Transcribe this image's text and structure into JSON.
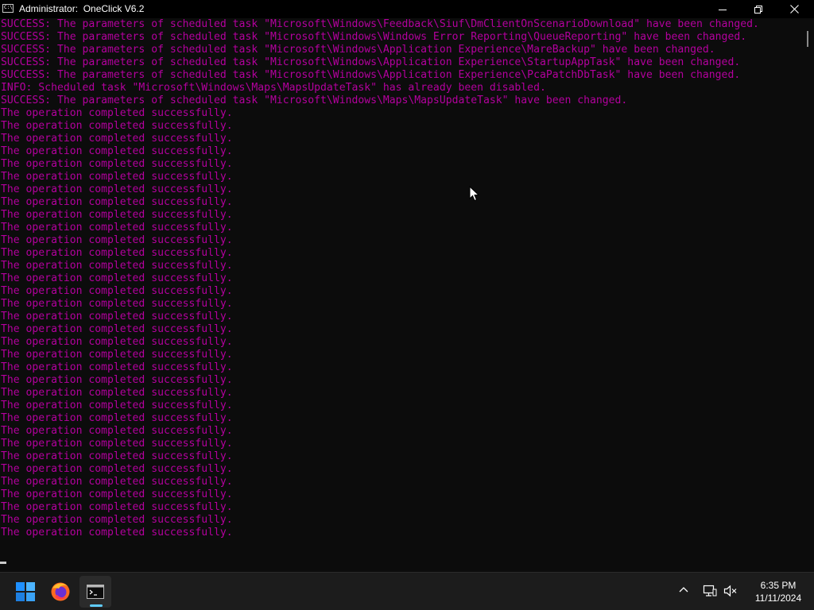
{
  "window": {
    "title": "Administrator:  OneClick V6.2",
    "icon": "command-prompt-icon",
    "icon_text": "C:\\",
    "controls": [
      "minimize-icon",
      "maximize-icon",
      "close-icon"
    ]
  },
  "console": {
    "text_color": "#b4009e",
    "background": "#0c0c0c",
    "lines": [
      "SUCCESS: The parameters of scheduled task \"Microsoft\\Windows\\Feedback\\Siuf\\DmClientOnScenarioDownload\" have been changed.",
      "SUCCESS: The parameters of scheduled task \"Microsoft\\Windows\\Windows Error Reporting\\QueueReporting\" have been changed.",
      "SUCCESS: The parameters of scheduled task \"Microsoft\\Windows\\Application Experience\\MareBackup\" have been changed.",
      "SUCCESS: The parameters of scheduled task \"Microsoft\\Windows\\Application Experience\\StartupAppTask\" have been changed.",
      "SUCCESS: The parameters of scheduled task \"Microsoft\\Windows\\Application Experience\\PcaPatchDbTask\" have been changed.",
      "INFO: Scheduled task \"Microsoft\\Windows\\Maps\\MapsUpdateTask\" has already been disabled.",
      "SUCCESS: The parameters of scheduled task \"Microsoft\\Windows\\Maps\\MapsUpdateTask\" have been changed.",
      "The operation completed successfully.",
      "The operation completed successfully.",
      "The operation completed successfully.",
      "The operation completed successfully.",
      "The operation completed successfully.",
      "The operation completed successfully.",
      "The operation completed successfully.",
      "The operation completed successfully.",
      "The operation completed successfully.",
      "The operation completed successfully.",
      "The operation completed successfully.",
      "The operation completed successfully.",
      "The operation completed successfully.",
      "The operation completed successfully.",
      "The operation completed successfully.",
      "The operation completed successfully.",
      "The operation completed successfully.",
      "The operation completed successfully.",
      "The operation completed successfully.",
      "The operation completed successfully.",
      "The operation completed successfully.",
      "The operation completed successfully.",
      "The operation completed successfully.",
      "The operation completed successfully.",
      "The operation completed successfully.",
      "The operation completed successfully.",
      "The operation completed successfully.",
      "The operation completed successfully.",
      "The operation completed successfully.",
      "The operation completed successfully.",
      "The operation completed successfully.",
      "The operation completed successfully.",
      "The operation completed successfully.",
      "The operation completed successfully."
    ]
  },
  "taskbar": {
    "apps": [
      {
        "name": "start",
        "icon": "windows-start-icon"
      },
      {
        "name": "firefox",
        "icon": "firefox-icon"
      },
      {
        "name": "terminal",
        "icon": "command-prompt-icon",
        "active": true
      }
    ],
    "accent_color": "#60cdff",
    "tray": {
      "icons": [
        "chevron-up-icon",
        "network-icon",
        "volume-muted-icon"
      ],
      "time": "6:35 PM",
      "date": "11/11/2024"
    }
  }
}
